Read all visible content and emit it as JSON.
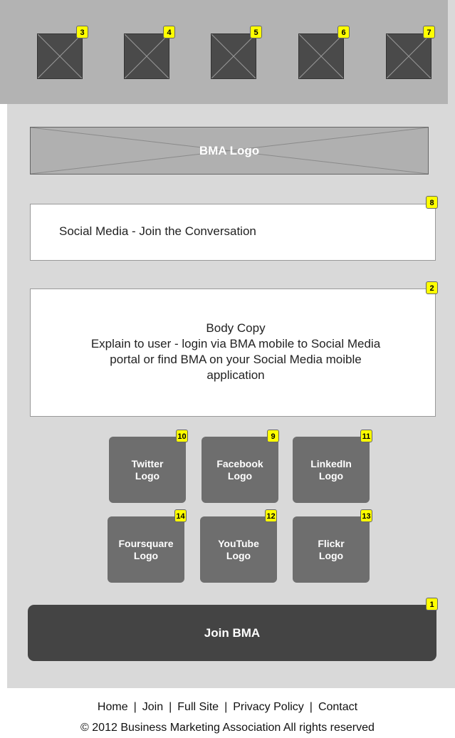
{
  "header": {
    "thumbnails": [
      {
        "badge": "3"
      },
      {
        "badge": "4"
      },
      {
        "badge": "5"
      },
      {
        "badge": "6"
      },
      {
        "badge": "7"
      }
    ]
  },
  "logo": {
    "label": "BMA Logo"
  },
  "social_title": {
    "text": "Social Media - Join the Conversation",
    "badge": "8"
  },
  "body_copy": {
    "lines": [
      "Body Copy",
      "Explain to user - login via BMA mobile to Social Media",
      "portal or find BMA on your Social Media moible",
      "application"
    ],
    "badge": "2"
  },
  "social_tiles": [
    {
      "label": "Twitter\nLogo",
      "badge": "10"
    },
    {
      "label": "Facebook\nLogo",
      "badge": "9"
    },
    {
      "label": "LinkedIn\nLogo",
      "badge": "11"
    },
    {
      "label": "Foursquare\nLogo",
      "badge": "14"
    },
    {
      "label": "YouTube\nLogo",
      "badge": "12"
    },
    {
      "label": "Flickr\nLogo",
      "badge": "13"
    }
  ],
  "join": {
    "label": "Join BMA",
    "badge": "1"
  },
  "footer": {
    "links": [
      "Home",
      "Join",
      "Full Site",
      "Privacy Policy",
      "Contact"
    ],
    "copyright": "© 2012 Business Marketing Association All rights reserved"
  },
  "colors": {
    "wireframe_bg": "#d9d9d9",
    "header_bg": "#b3b3b3",
    "badge": "#ffff00",
    "tile": "#6e6e6e",
    "button": "#444444"
  }
}
